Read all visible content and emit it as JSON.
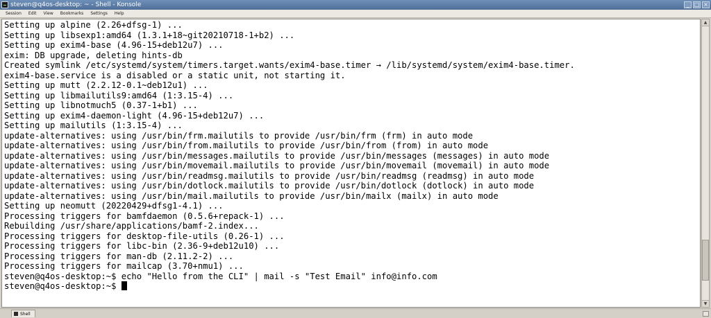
{
  "window": {
    "title": "steven@q4os-desktop: ~ - Shell - Konsole"
  },
  "menu": {
    "items": [
      "Session",
      "Edit",
      "View",
      "Bookmarks",
      "Settings",
      "Help"
    ]
  },
  "terminal": {
    "lines": [
      "Setting up alpine (2.26+dfsg-1) ...",
      "Setting up libsexp1:amd64 (1.3.1+18~git20210718-1+b2) ...",
      "Setting up exim4-base (4.96-15+deb12u7) ...",
      "exim: DB upgrade, deleting hints-db",
      "Created symlink /etc/systemd/system/timers.target.wants/exim4-base.timer → /lib/systemd/system/exim4-base.timer.",
      "exim4-base.service is a disabled or a static unit, not starting it.",
      "Setting up mutt (2.2.12-0.1~deb12u1) ...",
      "Setting up libmailutils9:amd64 (1:3.15-4) ...",
      "Setting up libnotmuch5 (0.37-1+b1) ...",
      "Setting up exim4-daemon-light (4.96-15+deb12u7) ...",
      "Setting up mailutils (1:3.15-4) ...",
      "update-alternatives: using /usr/bin/frm.mailutils to provide /usr/bin/frm (frm) in auto mode",
      "update-alternatives: using /usr/bin/from.mailutils to provide /usr/bin/from (from) in auto mode",
      "update-alternatives: using /usr/bin/messages.mailutils to provide /usr/bin/messages (messages) in auto mode",
      "update-alternatives: using /usr/bin/movemail.mailutils to provide /usr/bin/movemail (movemail) in auto mode",
      "update-alternatives: using /usr/bin/readmsg.mailutils to provide /usr/bin/readmsg (readmsg) in auto mode",
      "update-alternatives: using /usr/bin/dotlock.mailutils to provide /usr/bin/dotlock (dotlock) in auto mode",
      "update-alternatives: using /usr/bin/mail.mailutils to provide /usr/bin/mailx (mailx) in auto mode",
      "Setting up neomutt (20220429+dfsg1-4.1) ...",
      "Processing triggers for bamfdaemon (0.5.6+repack-1) ...",
      "Rebuilding /usr/share/applications/bamf-2.index...",
      "Processing triggers for desktop-file-utils (0.26-1) ...",
      "Processing triggers for libc-bin (2.36-9+deb12u10) ...",
      "Processing triggers for man-db (2.11.2-2) ...",
      "Processing triggers for mailcap (3.70+nmu1) ...",
      "steven@q4os-desktop:~$ echo \"Hello from the CLI\" | mail -s \"Test Email\" info@info.com"
    ],
    "prompt": "steven@q4os-desktop:~$ "
  },
  "scrollbar": {
    "position": 0.92,
    "visible_fraction": 0.15
  },
  "tabs": [
    {
      "label": "Shell",
      "icon": "terminal-icon",
      "active": true
    }
  ]
}
